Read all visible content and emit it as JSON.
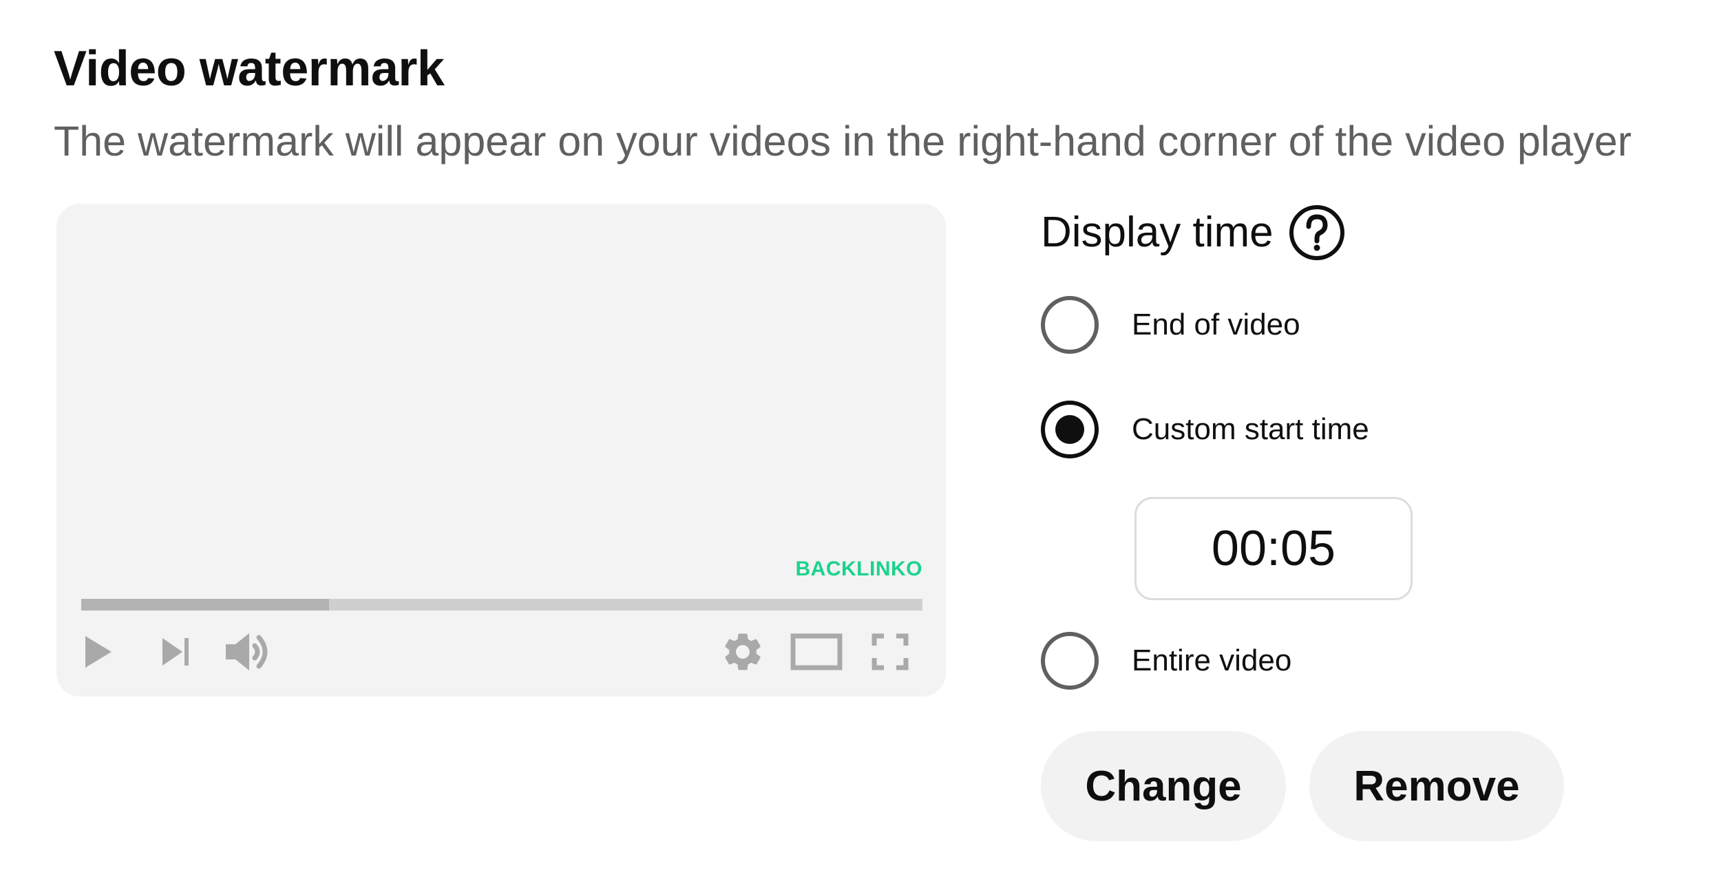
{
  "header": {
    "title": "Video watermark",
    "subtitle": "The watermark will appear on your videos in the right-hand corner of the video player"
  },
  "preview": {
    "watermark_text": "BACKLINKO",
    "watermark_color": "#1bd38c",
    "progress_fraction": 0.295,
    "controls": [
      "play-icon",
      "next-icon",
      "volume-icon",
      "settings-gear-icon",
      "theater-mode-icon",
      "fullscreen-icon"
    ]
  },
  "display_time": {
    "label": "Display time",
    "help_icon": "question-mark-icon",
    "options": [
      {
        "label": "End of video",
        "checked": false
      },
      {
        "label": "Custom start time",
        "checked": true
      },
      {
        "label": "Entire video",
        "checked": false
      }
    ],
    "custom_start_value": "00:05"
  },
  "actions": {
    "change_label": "Change",
    "remove_label": "Remove"
  }
}
